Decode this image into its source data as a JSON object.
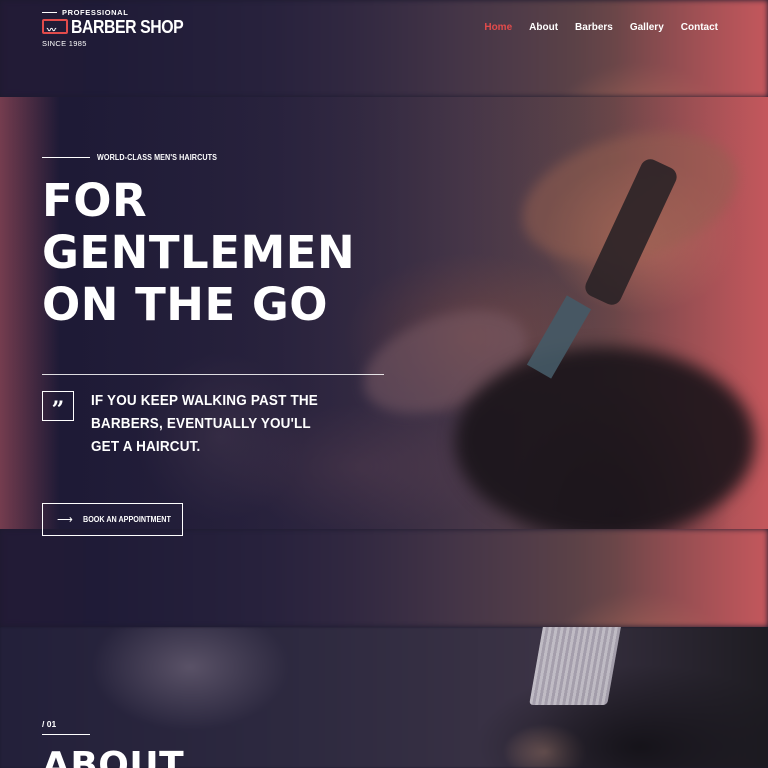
{
  "brand": {
    "tagline_top": "PROFESSIONAL",
    "name": "BARBER SHOP",
    "since": "SINCE 1985",
    "accent_color": "#e24b4b"
  },
  "nav": {
    "items": [
      {
        "label": "Home",
        "active": true
      },
      {
        "label": "About",
        "active": false
      },
      {
        "label": "Barbers",
        "active": false
      },
      {
        "label": "Gallery",
        "active": false
      },
      {
        "label": "Contact",
        "active": false
      }
    ]
  },
  "hero": {
    "eyebrow": "WORLD-CLASS MEN'S HAIRCUTS",
    "headline": [
      "FOR",
      "GENTLEMEN",
      "ON THE GO"
    ],
    "quote_icon": "quote-icon",
    "quote": "IF YOU KEEP WALKING PAST THE BARBERS, EVENTUALLY YOU'LL GET A HAIRCUT.",
    "cta_label": "BOOK AN APPOINTMENT",
    "cta_icon": "arrow-right-icon"
  },
  "about": {
    "number": "/ 01",
    "title": "ABOUT"
  }
}
